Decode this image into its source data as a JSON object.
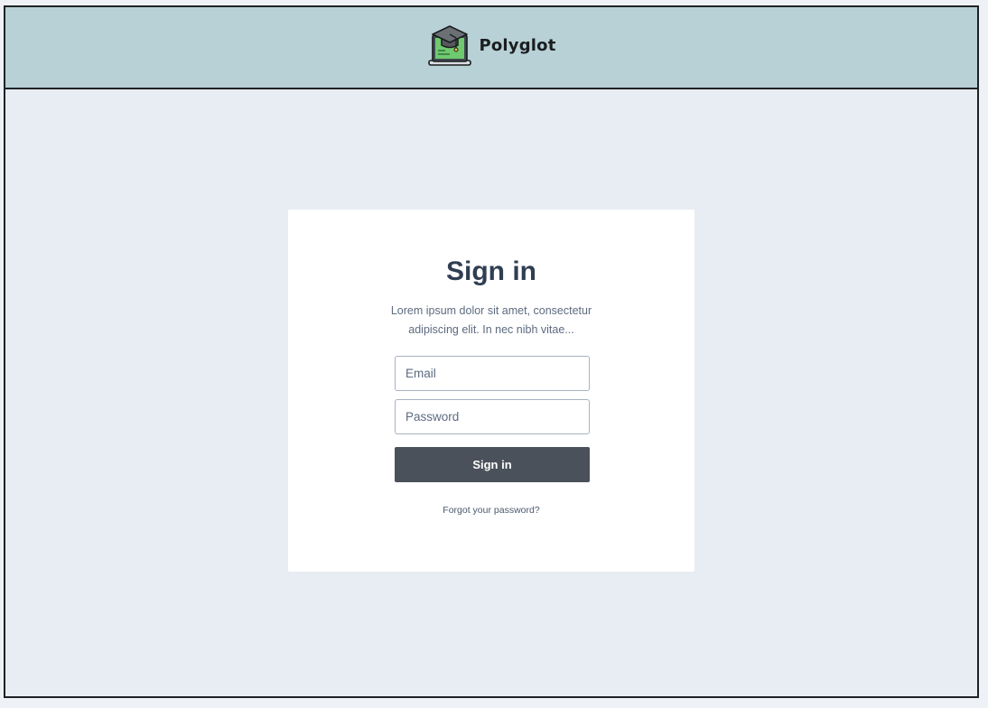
{
  "header": {
    "app_name": "Polyglot",
    "logo_icon": "laptop-graduation-cap-icon",
    "background": "#b7d1d6"
  },
  "signin_card": {
    "title": "Sign in",
    "description": "Lorem ipsum dolor sit amet, consectetur adipiscing elit. In nec nibh vitae...",
    "email_placeholder": "Email",
    "email_value": "",
    "password_placeholder": "Password",
    "password_value": "",
    "submit_label": "Sign in",
    "forgot_link": "Forgot your password?"
  },
  "colors": {
    "page_background": "#e8ecf3",
    "button_background": "#4a515a",
    "title_color": "#2f3e52",
    "logo_screen_green": "#6fc96f"
  }
}
